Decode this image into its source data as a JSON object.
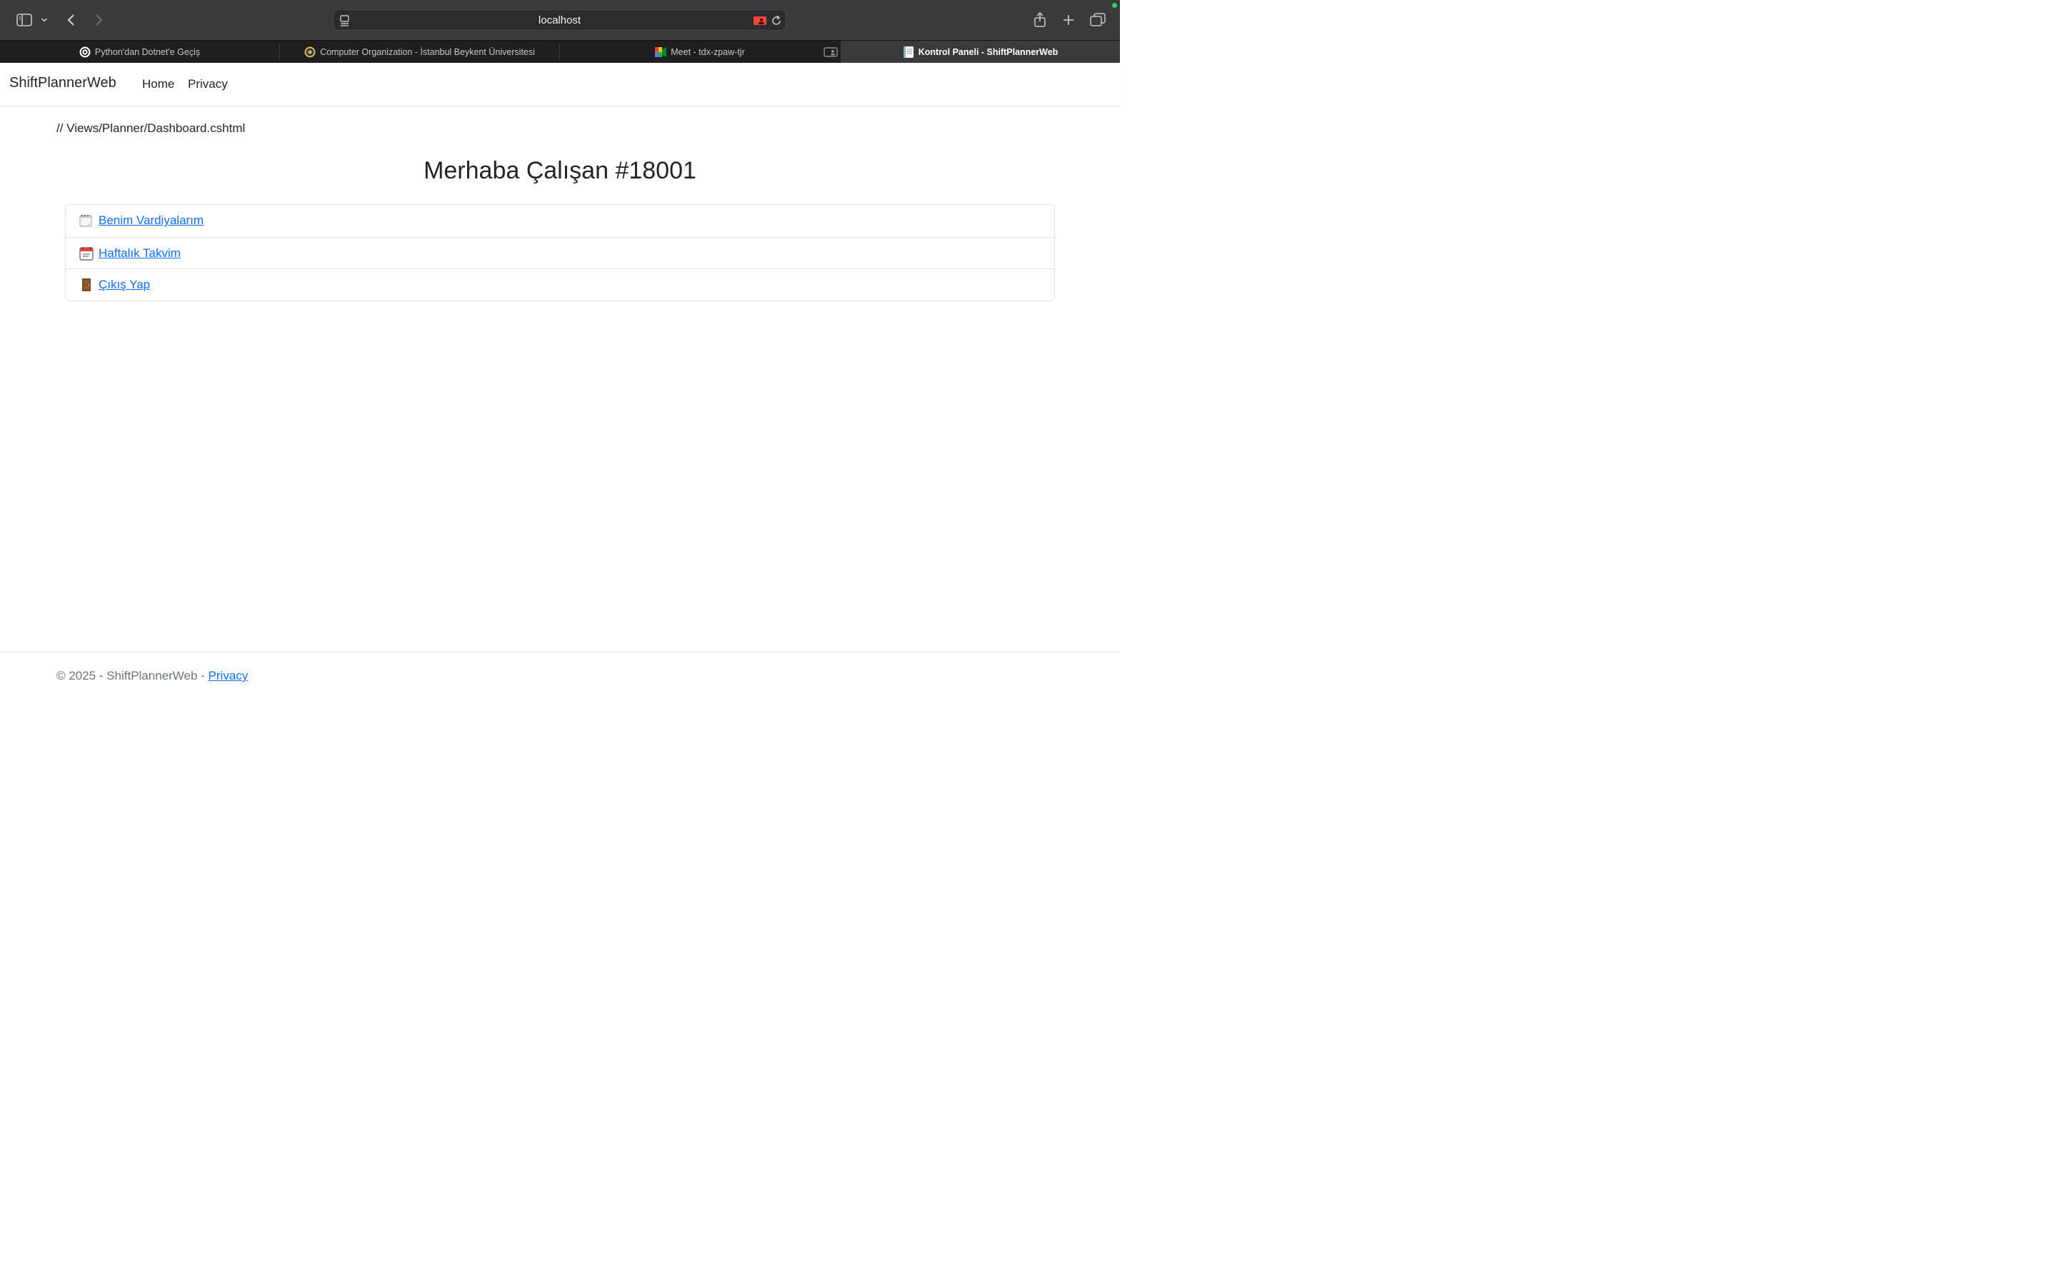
{
  "browser": {
    "address": "localhost",
    "tabs": [
      {
        "title": "Python'dan Dotnet'e Geçiş",
        "icon": "openai-icon",
        "active": false
      },
      {
        "title": "Computer Organization - İstanbul Beykent Üniversitesi",
        "icon": "university-seal-icon",
        "active": false
      },
      {
        "title": "Meet - tdx-zpaw-tjr",
        "icon": "google-meet-icon",
        "active": false
      },
      {
        "title": "",
        "icon": "screen-share-icon",
        "active": false
      },
      {
        "title": "Kontrol Paneli - ShiftPlannerWeb",
        "icon": "document-icon",
        "active": true
      }
    ]
  },
  "navbar": {
    "brand": "ShiftPlannerWeb",
    "links": [
      "Home",
      "Privacy"
    ]
  },
  "main": {
    "comment": "// Views/Planner/Dashboard.cshtml",
    "title": "Merhaba Çalışan #18001",
    "menu": [
      {
        "icon": "spiral-notepad-icon",
        "label": "Benim Vardiyalarım"
      },
      {
        "icon": "calendar-icon",
        "label": "Haftalık Takvim"
      },
      {
        "icon": "door-icon",
        "label": "Çıkış Yap"
      }
    ]
  },
  "footer": {
    "text": "© 2025 - ShiftPlannerWeb - ",
    "link": "Privacy"
  },
  "colors": {
    "link": "#0d6efd",
    "chrome_toolbar": "#3a3a3c",
    "chrome_tabbar": "#1f1f21"
  }
}
